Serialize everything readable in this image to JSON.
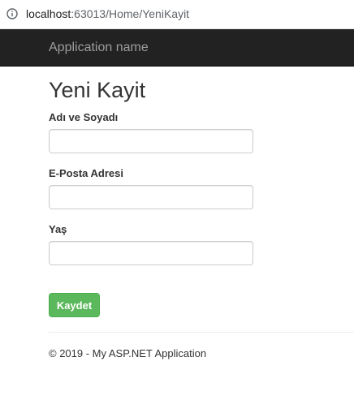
{
  "browser": {
    "url_host": "localhost",
    "url_rest": ":63013/Home/YeniKayit",
    "info_icon": "info-icon"
  },
  "navbar": {
    "brand": "Application name"
  },
  "form": {
    "title": "Yeni Kayit",
    "fields": [
      {
        "label": "Adı ve Soyadı",
        "value": ""
      },
      {
        "label": "E-Posta Adresi",
        "value": ""
      },
      {
        "label": "Yaş",
        "value": ""
      }
    ],
    "submit_label": "Kaydet"
  },
  "footer": {
    "text": "© 2019 - My ASP.NET Application"
  },
  "colors": {
    "navbar_bg": "#222222",
    "brand_text": "#9d9d9d",
    "success_button": "#5cb85c"
  }
}
